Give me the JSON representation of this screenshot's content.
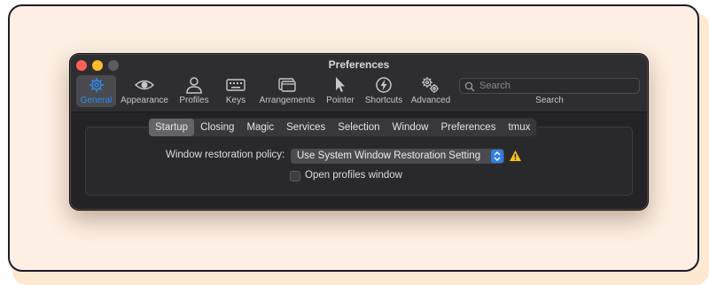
{
  "window": {
    "title": "Preferences"
  },
  "toolbar": {
    "items": [
      {
        "label": "General",
        "icon": "gear-icon",
        "active": true
      },
      {
        "label": "Appearance",
        "icon": "eye-icon",
        "active": false
      },
      {
        "label": "Profiles",
        "icon": "person-icon",
        "active": false
      },
      {
        "label": "Keys",
        "icon": "keyboard-icon",
        "active": false
      },
      {
        "label": "Arrangements",
        "icon": "windows-icon",
        "active": false
      },
      {
        "label": "Pointer",
        "icon": "cursor-icon",
        "active": false
      },
      {
        "label": "Shortcuts",
        "icon": "bolt-icon",
        "active": false
      },
      {
        "label": "Advanced",
        "icon": "gears-icon",
        "active": false
      }
    ],
    "search": {
      "placeholder": "Search",
      "label": "Search"
    }
  },
  "tabs": [
    {
      "label": "Startup",
      "active": true
    },
    {
      "label": "Closing",
      "active": false
    },
    {
      "label": "Magic",
      "active": false
    },
    {
      "label": "Services",
      "active": false
    },
    {
      "label": "Selection",
      "active": false
    },
    {
      "label": "Window",
      "active": false
    },
    {
      "label": "Preferences",
      "active": false
    },
    {
      "label": "tmux",
      "active": false
    }
  ],
  "startup": {
    "restoration_label": "Window restoration policy:",
    "restoration_value": "Use System Window Restoration Setting",
    "open_profiles_label": "Open profiles window",
    "open_profiles_checked": false
  },
  "colors": {
    "accent": "#2f8cf5",
    "warning": "#f5c518",
    "window_bg": "#232325",
    "card_bg": "#fdefe3"
  }
}
